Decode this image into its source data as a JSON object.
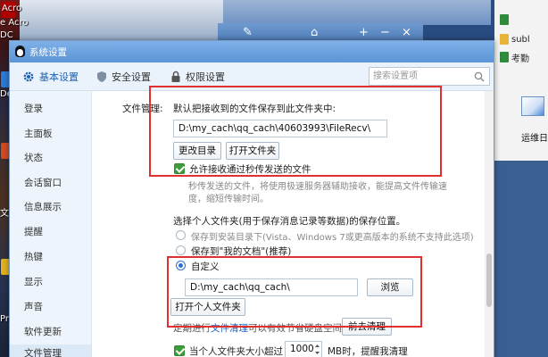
{
  "desktop": {
    "left_labels": [
      "Acro",
      "e Acro",
      "DC",
      "De",
      "文",
      "Pr"
    ],
    "right_items": [
      "",
      "subl",
      "考勤"
    ],
    "right_desktop_label": "运维日",
    "viewer_controls": [
      "✎",
      "⌂",
      "+",
      "−",
      "×"
    ]
  },
  "window": {
    "title": "系统设置",
    "tabs": [
      {
        "label": "基本设置",
        "icon": "gear-icon"
      },
      {
        "label": "安全设置",
        "icon": "shield-icon"
      },
      {
        "label": "权限设置",
        "icon": "lock-icon"
      }
    ],
    "search_placeholder": "搜索设置项",
    "sidebar": [
      "登录",
      "主面板",
      "状态",
      "会话窗口",
      "信息展示",
      "提醒",
      "热键",
      "显示",
      "声音",
      "软件更新",
      "文件管理"
    ],
    "sidebar_selected": "文件管理"
  },
  "content": {
    "section_label": "文件管理:",
    "default_folder_label": "默认把接收到的文件保存到此文件夹中:",
    "default_folder_path": "D:\\my_cach\\qq_cach\\40603993\\FileRecv\\",
    "change_dir_button": "更改目录",
    "open_folder_button": "打开文件夹",
    "allow_fast_transfer": "允许接收通过秒传发送的文件",
    "fast_transfer_desc_1": "秒传发送的文件，将使用极速服务器辅助接收，能提高文件传输速",
    "fast_transfer_desc_2": "度，缩短传输时间。",
    "personal_folder_label": "选择个人文件夹(用于保存消息记录等数据)的保存位置。",
    "option_install_dir": "保存到安装目录下(Vista、Windows 7或更高版本的系统不支持此选项)",
    "option_my_docs": "保存到\"我的文档\"(推荐)",
    "option_custom": "自定义",
    "custom_path": "D:\\my_cach\\qq_cach\\",
    "browse_button": "浏览",
    "open_personal_button": "打开个人文件夹",
    "cleanup_text_pre": "定期进行",
    "cleanup_link": "文件清理",
    "cleanup_text_post": "可以有效节省硬盘空间。",
    "cleanup_button": "前去清理",
    "size_limit_pre": "当个人文件夹大小超过",
    "size_limit_value": "1000",
    "size_limit_post": "MB时，提醒我清理"
  },
  "colors": {
    "accent": "#1e62b4",
    "highlight": "#e03030",
    "check": "#3c9c3c"
  }
}
